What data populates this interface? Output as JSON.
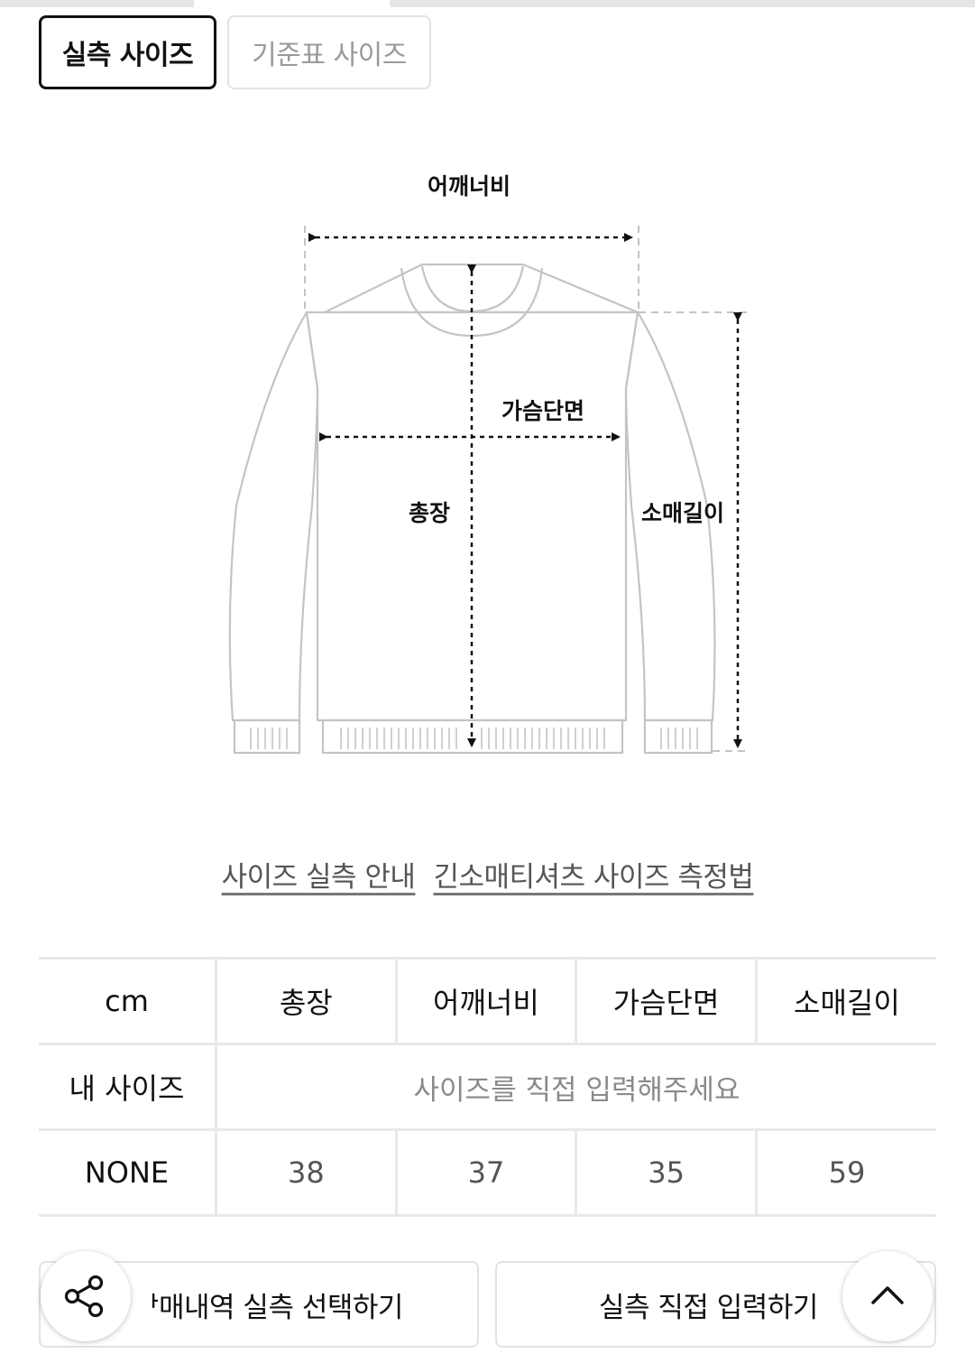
{
  "tabs": [
    {
      "label": "실측 사이즈",
      "active": true
    },
    {
      "label": "기준표 사이즈",
      "active": false
    }
  ],
  "diagram": {
    "shoulder": "어깨너비",
    "chest": "가슴단면",
    "length": "총장",
    "sleeve": "소매길이"
  },
  "links": {
    "guide": "사이즈 실측 안내",
    "method": "긴소매티셔츠 사이즈 측정법"
  },
  "table": {
    "headers": [
      "cm",
      "총장",
      "어깨너비",
      "가슴단면",
      "소매길이"
    ],
    "my_size_label": "내 사이즈",
    "my_size_placeholder": "사이즈를 직접 입력해주세요",
    "rows": [
      {
        "size": "NONE",
        "values": [
          "38",
          "37",
          "35",
          "59"
        ]
      }
    ]
  },
  "buttons": {
    "history": "ᅡ매내역 실측 선택하기",
    "manual": "실측 직접 입력하기"
  },
  "icons": {
    "share": "share-icon",
    "scroll_top": "chevron-up-icon"
  }
}
